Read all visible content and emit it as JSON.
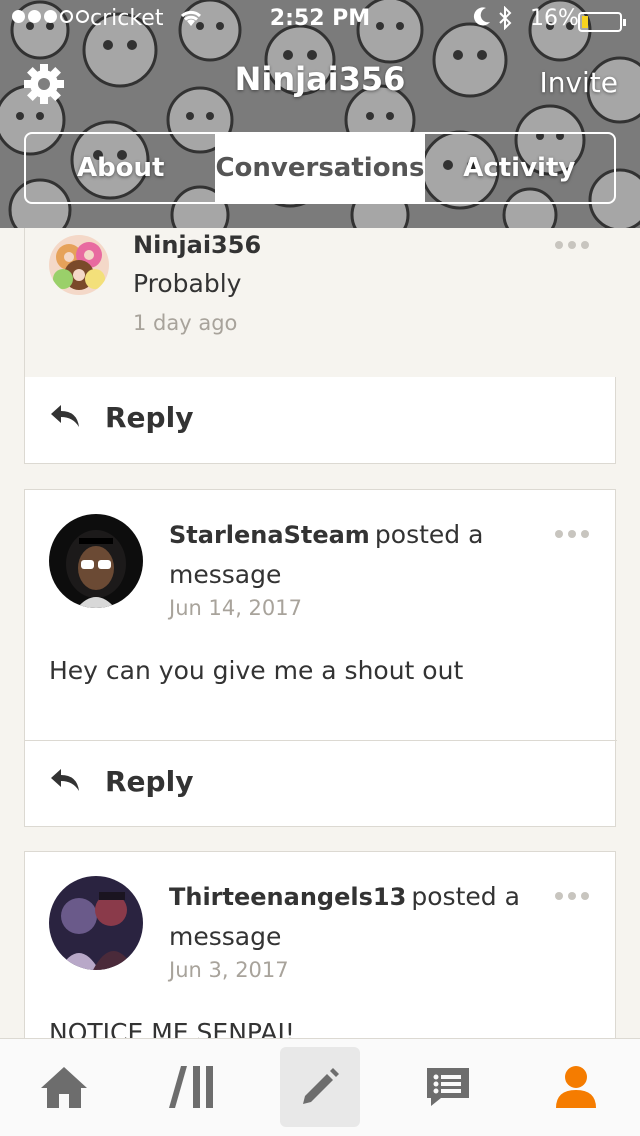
{
  "status_bar": {
    "carrier": "cricket",
    "time": "2:52 PM",
    "battery_percent": "16%",
    "battery_level": 0.16,
    "signal_dots_filled": 3,
    "signal_dots_total": 5,
    "battery_color": "#f7d21e"
  },
  "nav": {
    "title": "Ninjai356",
    "invite_label": "Invite",
    "settings_icon": "gear-icon"
  },
  "tabs": [
    {
      "label": "About",
      "active": false
    },
    {
      "label": "Conversations",
      "active": true
    },
    {
      "label": "Activity",
      "active": false
    }
  ],
  "feed": [
    {
      "author": "Ninjai356",
      "action": "",
      "text": "Probably",
      "time": "1 day ago",
      "reply_label": "Reply"
    },
    {
      "author": "StarlenaSteam",
      "action": "posted a message",
      "text": "Hey can you give me a shout out",
      "time": "Jun 14, 2017",
      "reply_label": "Reply"
    },
    {
      "author": "Thirteenangels13",
      "action": "posted a message",
      "text": "NOTICE ME SENPAI!",
      "time": "Jun 3, 2017"
    }
  ],
  "tabbar": {
    "items": [
      "home-icon",
      "library-icon",
      "write-icon",
      "messages-icon",
      "profile-icon"
    ],
    "selected": "write-icon",
    "accent": "#f57c00",
    "icon_color": "#6d6d6d"
  }
}
